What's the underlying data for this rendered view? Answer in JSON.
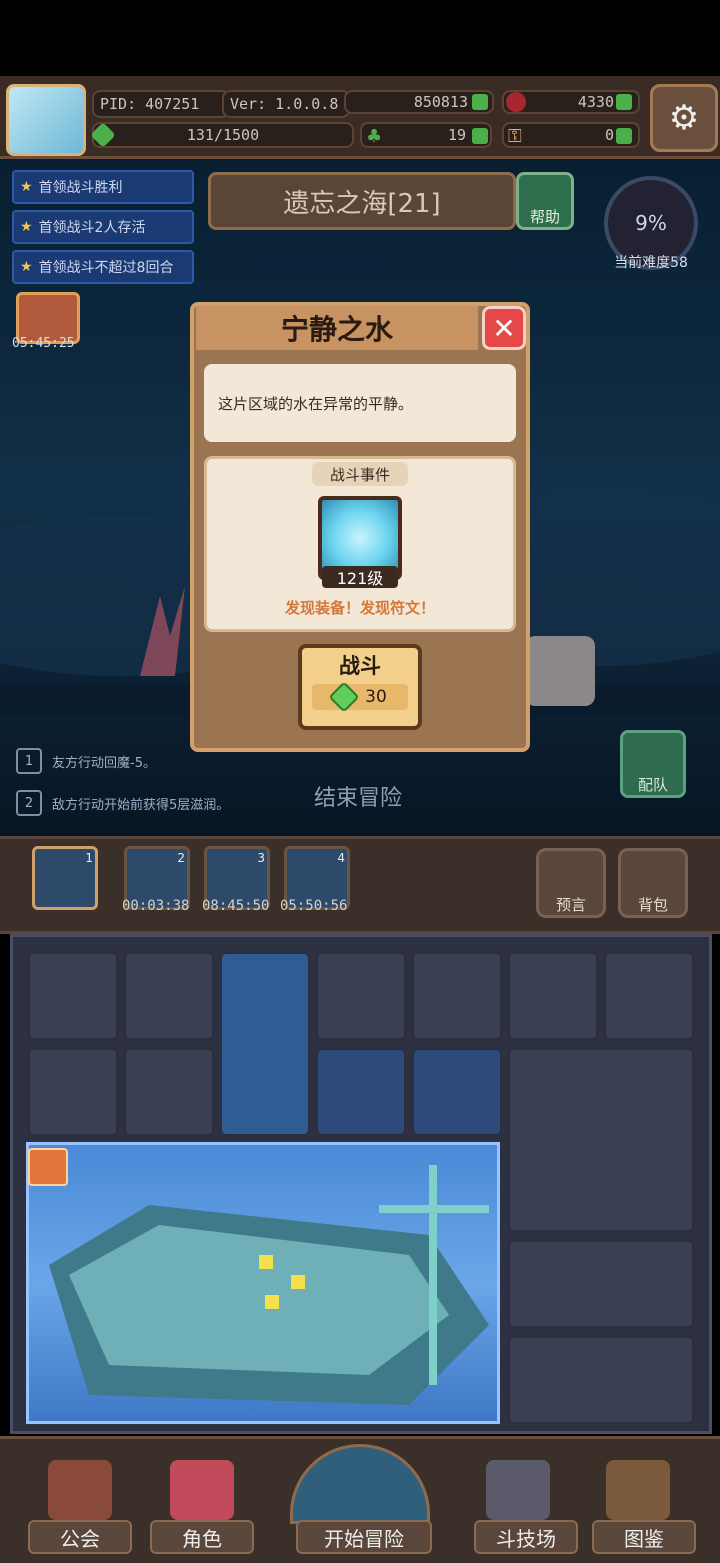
{
  "player": {
    "pid": "PID: 407251",
    "version": "Ver: 1.0.0.8",
    "gold": "850813",
    "red_currency": "4330",
    "energy": "131/1500",
    "clover": "19",
    "key": "0"
  },
  "quests": [
    "首领战斗胜利",
    "首领战斗2人存活",
    "首领战斗不超过8回合"
  ],
  "gift_timer": "05:45:25",
  "zone": {
    "name": "遗忘之海[21]",
    "help_label": "帮助"
  },
  "difficulty": {
    "percent": "9%",
    "label": "当前难度58"
  },
  "modal": {
    "title": "宁静之水",
    "description": "这片区域的水在异常的平静。",
    "event_label": "战斗事件",
    "item_level": "121级",
    "found_text": "发现装备！发现符文！",
    "fight_label": "战斗",
    "fight_cost": "30"
  },
  "rules": [
    {
      "num": "1",
      "text": "友方行动回魔-5。"
    },
    {
      "num": "2",
      "text": "敌方行动开始前获得5层滋润。"
    }
  ],
  "end_button": "结束冒险",
  "team_button": "配队",
  "slots": [
    {
      "num": "1",
      "timer": ""
    },
    {
      "num": "2",
      "timer": "00:03:38"
    },
    {
      "num": "3",
      "timer": "08:45:50"
    },
    {
      "num": "4",
      "timer": "05:50:56"
    }
  ],
  "side_buttons": {
    "prophecy": "预言",
    "bag": "背包"
  },
  "nav": [
    "公会",
    "角色",
    "开始冒险",
    "斗技场",
    "图鉴"
  ],
  "colors": {
    "accent": "#d2a06a",
    "close": "#e54848",
    "gem": "#5fcf5a",
    "found_text": "#d6773a"
  }
}
